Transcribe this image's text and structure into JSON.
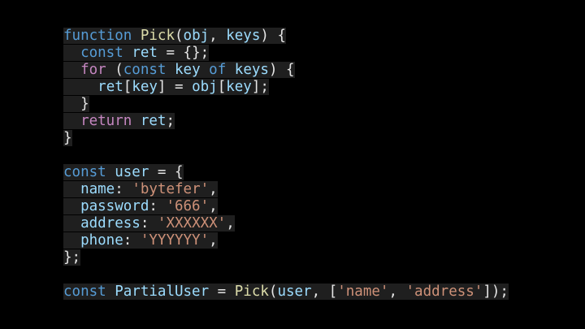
{
  "editor": {
    "colors": {
      "background": "#000000",
      "line_highlight": "#1f1f1f",
      "keyword": "#569cd6",
      "control": "#c586c0",
      "function": "#dcdcaa",
      "variable": "#9cdcfe",
      "string": "#ce9178",
      "text": "#e6e6e6"
    },
    "lines": [
      [
        {
          "t": "function",
          "c": "kw"
        },
        {
          "t": " ",
          "c": "txt"
        },
        {
          "t": "Pick",
          "c": "fn"
        },
        {
          "t": "(",
          "c": "txt"
        },
        {
          "t": "obj",
          "c": "var"
        },
        {
          "t": ", ",
          "c": "txt"
        },
        {
          "t": "keys",
          "c": "var"
        },
        {
          "t": ") {",
          "c": "txt"
        }
      ],
      [
        {
          "t": "  ",
          "c": "txt"
        },
        {
          "t": "const",
          "c": "kw"
        },
        {
          "t": " ",
          "c": "txt"
        },
        {
          "t": "ret",
          "c": "var"
        },
        {
          "t": " = {};",
          "c": "txt"
        }
      ],
      [
        {
          "t": "  ",
          "c": "txt"
        },
        {
          "t": "for",
          "c": "ctrl"
        },
        {
          "t": " (",
          "c": "txt"
        },
        {
          "t": "const",
          "c": "kw"
        },
        {
          "t": " ",
          "c": "txt"
        },
        {
          "t": "key",
          "c": "var"
        },
        {
          "t": " ",
          "c": "txt"
        },
        {
          "t": "of",
          "c": "kw"
        },
        {
          "t": " ",
          "c": "txt"
        },
        {
          "t": "keys",
          "c": "var"
        },
        {
          "t": ") {",
          "c": "txt"
        }
      ],
      [
        {
          "t": "    ",
          "c": "txt"
        },
        {
          "t": "ret",
          "c": "var"
        },
        {
          "t": "[",
          "c": "txt"
        },
        {
          "t": "key",
          "c": "var"
        },
        {
          "t": "] = ",
          "c": "txt"
        },
        {
          "t": "obj",
          "c": "var"
        },
        {
          "t": "[",
          "c": "txt"
        },
        {
          "t": "key",
          "c": "var"
        },
        {
          "t": "];",
          "c": "txt"
        }
      ],
      [
        {
          "t": "  }",
          "c": "txt"
        }
      ],
      [
        {
          "t": "  ",
          "c": "txt"
        },
        {
          "t": "return",
          "c": "ctrl"
        },
        {
          "t": " ",
          "c": "txt"
        },
        {
          "t": "ret",
          "c": "var"
        },
        {
          "t": ";",
          "c": "txt"
        }
      ],
      [
        {
          "t": "}",
          "c": "txt"
        }
      ],
      [],
      [
        {
          "t": "const",
          "c": "kw"
        },
        {
          "t": " ",
          "c": "txt"
        },
        {
          "t": "user",
          "c": "var"
        },
        {
          "t": " = {",
          "c": "txt"
        }
      ],
      [
        {
          "t": "  ",
          "c": "txt"
        },
        {
          "t": "name",
          "c": "var"
        },
        {
          "t": ": ",
          "c": "txt"
        },
        {
          "t": "'bytefer'",
          "c": "str"
        },
        {
          "t": ",",
          "c": "txt"
        }
      ],
      [
        {
          "t": "  ",
          "c": "txt"
        },
        {
          "t": "password",
          "c": "var"
        },
        {
          "t": ": ",
          "c": "txt"
        },
        {
          "t": "'666'",
          "c": "str"
        },
        {
          "t": ",",
          "c": "txt"
        }
      ],
      [
        {
          "t": "  ",
          "c": "txt"
        },
        {
          "t": "address",
          "c": "var"
        },
        {
          "t": ": ",
          "c": "txt"
        },
        {
          "t": "'XXXXXX'",
          "c": "str"
        },
        {
          "t": ",",
          "c": "txt"
        }
      ],
      [
        {
          "t": "  ",
          "c": "txt"
        },
        {
          "t": "phone",
          "c": "var"
        },
        {
          "t": ": ",
          "c": "txt"
        },
        {
          "t": "'YYYYYY'",
          "c": "str"
        },
        {
          "t": ",",
          "c": "txt"
        }
      ],
      [
        {
          "t": "};",
          "c": "txt"
        }
      ],
      [],
      [
        {
          "t": "const",
          "c": "kw"
        },
        {
          "t": " ",
          "c": "txt"
        },
        {
          "t": "PartialUser",
          "c": "var"
        },
        {
          "t": " = ",
          "c": "txt"
        },
        {
          "t": "Pick",
          "c": "fn"
        },
        {
          "t": "(",
          "c": "txt"
        },
        {
          "t": "user",
          "c": "var"
        },
        {
          "t": ", [",
          "c": "txt"
        },
        {
          "t": "'name'",
          "c": "str"
        },
        {
          "t": ", ",
          "c": "txt"
        },
        {
          "t": "'address'",
          "c": "str"
        },
        {
          "t": "]);",
          "c": "txt"
        }
      ]
    ]
  }
}
